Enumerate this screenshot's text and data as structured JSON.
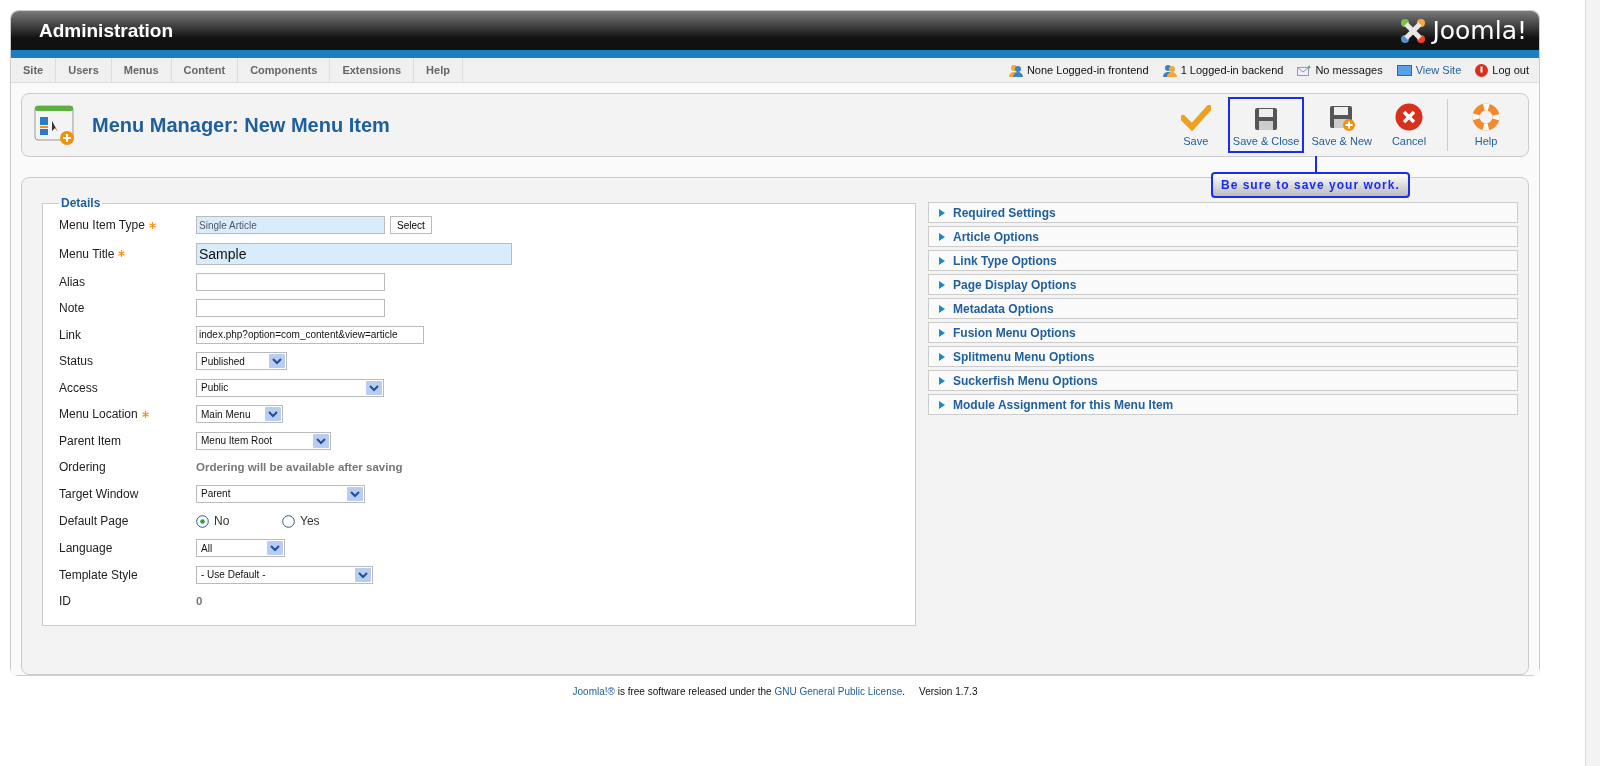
{
  "header": {
    "title": "Administration",
    "logo_text": "Joomla!"
  },
  "menu": [
    {
      "label": "Site"
    },
    {
      "label": "Users"
    },
    {
      "label": "Menus"
    },
    {
      "label": "Content"
    },
    {
      "label": "Components"
    },
    {
      "label": "Extensions"
    },
    {
      "label": "Help"
    }
  ],
  "status": [
    {
      "label": "None Logged-in frontend",
      "kind": "text"
    },
    {
      "label": "1 Logged-in backend",
      "kind": "text"
    },
    {
      "label": "No messages",
      "kind": "text"
    },
    {
      "label": "View Site",
      "kind": "link"
    },
    {
      "label": "Log out",
      "kind": "text"
    }
  ],
  "page_title": "Menu Manager: New Menu Item",
  "toolbar": [
    {
      "label": "Save",
      "highlighted": false
    },
    {
      "label": "Save & Close",
      "highlighted": true
    },
    {
      "label": "Save & New",
      "highlighted": false
    },
    {
      "label": "Cancel",
      "highlighted": false
    },
    {
      "label": "Help",
      "highlighted": false
    }
  ],
  "callout": "Be sure to save your work.",
  "details": {
    "legend": "Details",
    "fields": [
      {
        "label": "Menu Item Type",
        "required": true,
        "kind": "picker",
        "value": "Single Article",
        "button": "Select"
      },
      {
        "label": "Menu Title",
        "required": true,
        "kind": "title",
        "value": "Sample"
      },
      {
        "label": "Alias",
        "required": false,
        "kind": "text"
      },
      {
        "label": "Note",
        "required": false,
        "kind": "text"
      },
      {
        "label": "Link",
        "required": false,
        "kind": "text",
        "value": "index.php?option=com_content&view=article"
      },
      {
        "label": "Status",
        "required": false,
        "kind": "select",
        "value": "Published"
      },
      {
        "label": "Access",
        "required": false,
        "kind": "select",
        "value": "Public"
      },
      {
        "label": "Menu Location",
        "required": true,
        "kind": "select",
        "value": "Main Menu"
      },
      {
        "label": "Parent Item",
        "required": false,
        "kind": "select",
        "value": "Menu Item Root"
      },
      {
        "label": "Ordering",
        "required": false,
        "kind": "static",
        "value": "Ordering will be available after saving"
      },
      {
        "label": "Target Window",
        "required": false,
        "kind": "select",
        "value": "Parent"
      },
      {
        "label": "Default Page",
        "required": false,
        "kind": "radio",
        "options": [
          {
            "label": "No",
            "selected": true
          },
          {
            "label": "Yes",
            "selected": false
          }
        ]
      },
      {
        "label": "Language",
        "required": false,
        "kind": "select",
        "value": "All"
      },
      {
        "label": "Template Style",
        "required": false,
        "kind": "select",
        "value": "- Use Default -"
      },
      {
        "label": "ID",
        "required": false,
        "kind": "static",
        "value": "0"
      }
    ]
  },
  "panels": [
    {
      "label": "Required Settings",
      "expanded": false
    },
    {
      "label": "Article Options",
      "expanded": false
    },
    {
      "label": "Link Type Options",
      "expanded": false
    },
    {
      "label": "Page Display Options",
      "expanded": false
    },
    {
      "label": "Metadata Options",
      "expanded": false
    },
    {
      "label": "Fusion Menu Options",
      "expanded": false
    },
    {
      "label": "Splitmenu Menu Options",
      "expanded": false
    },
    {
      "label": "Suckerfish Menu Options",
      "expanded": false
    },
    {
      "label": "Module Assignment for this Menu Item",
      "expanded": false
    }
  ],
  "footer": {
    "parts": [
      {
        "kind": "link",
        "text": "Joomla!®"
      },
      {
        "kind": "text",
        "text": " is free software released under the "
      },
      {
        "kind": "link",
        "text": "GNU General Public License"
      },
      {
        "kind": "text",
        "text": "."
      }
    ],
    "version": "Version 1.7.3"
  }
}
